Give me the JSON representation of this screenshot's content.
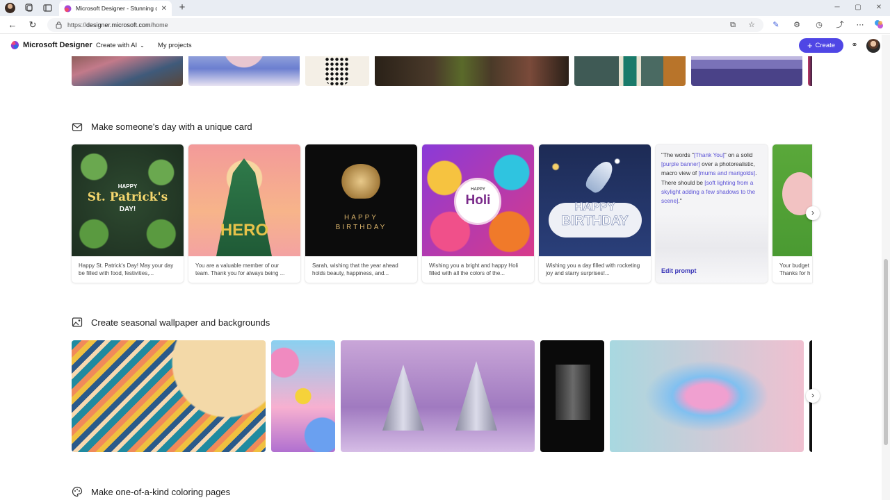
{
  "browser": {
    "tab_title": "Microsoft Designer - Stunning de",
    "url_prefix": "https://",
    "url_host": "designer.microsoft.com",
    "url_path": "/home"
  },
  "app": {
    "brand": "Microsoft Designer",
    "menu_create": "Create with AI",
    "menu_projects": "My projects",
    "create_button": "Create"
  },
  "sections": {
    "cards_title": "Make someone's day with a unique card",
    "wallpaper_title": "Create seasonal wallpaper and backgrounds",
    "coloring_title": "Make one-of-a-kind coloring pages"
  },
  "cards": [
    {
      "caption": "Happy St. Patrick's Day! May your day be filled with food, festivities,...",
      "art_line1": "HAPPY",
      "art_line2": "St. Patrick's",
      "art_line3": "DAY!"
    },
    {
      "caption": "You are a valuable member of our team. Thank you for always being ...",
      "art_line1": "HERO"
    },
    {
      "caption": "Sarah, wishing that the year ahead holds beauty, happiness, and...",
      "art_line1": "HAPPY",
      "art_line2": "BIRTHDAY"
    },
    {
      "caption": "Wishing you a bright and happy Holi filled with all the colors of the...",
      "art_line1": "HAPPY",
      "art_line2": "Holi"
    },
    {
      "caption": "Wishing you a day filled with rocketing joy and starry surprises!...",
      "art_line1": "HAPPY",
      "art_line2": "BIRTHDAY"
    },
    {
      "caption": "Your budget",
      "caption2": "Thanks for h"
    }
  ],
  "prompt_card": {
    "p1": "\"The words \"",
    "h1": "[Thank You]",
    "p2": "\" on a solid ",
    "h2": "[purple banner]",
    "p3": " over a photorealistic, macro view of ",
    "h3": "[mums and marigolds]",
    "p4": ". There should be ",
    "h4": "[soft lighting from a skylight adding a few shadows to the scene]",
    "p5": ".\"",
    "edit_label": "Edit prompt"
  },
  "icons": {
    "card_section": "mail-icon",
    "wallpaper_section": "image-icon",
    "coloring_section": "palette-icon",
    "carousel_next": "chevron-right-icon"
  },
  "colors": {
    "accent": "#4f46e5",
    "prompt_highlight": "#5b52d6"
  }
}
